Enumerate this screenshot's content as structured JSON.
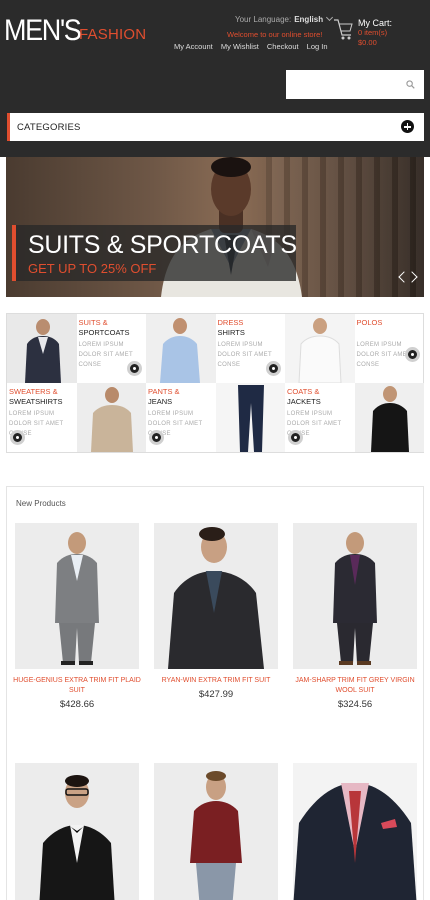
{
  "header": {
    "logo_main": "MEN'S",
    "logo_sub": "FASHION",
    "language_label": "Your Language:",
    "language_value": "English",
    "welcome": "Welcome to our online store!",
    "links": [
      "My Account",
      "My Wishlist",
      "Checkout",
      "Log In"
    ],
    "cart_title": "My Cart:",
    "cart_items": "0 item(s)",
    "cart_total": "$0.00",
    "search_placeholder": ""
  },
  "nav": {
    "categories_label": "CATEGORIES"
  },
  "banner": {
    "title": "SUITS & SPORTCOATS",
    "subtitle": "GET UP TO 25% OFF"
  },
  "categories": [
    {
      "line1": "SUITS &",
      "line2": "SPORTCOATS",
      "desc": "LOREM IPSUM DOLOR SIT AMET CONSE"
    },
    {
      "line1": "DRESS",
      "line2": "SHIRTS",
      "desc": "LOREM IPSUM DOLOR SIT AMET CONSE"
    },
    {
      "line1": "POLOS",
      "line2": "",
      "desc": "LOREM IPSUM DOLOR SIT AMET CONSE"
    },
    {
      "line1": "SWEATERS &",
      "line2": "SWEATSHIRTS",
      "desc": "LOREM IPSUM DOLOR SIT AMET CONSE"
    },
    {
      "line1": "PANTS &",
      "line2": "JEANS",
      "desc": "LOREM IPSUM DOLOR SIT AMET CONSE"
    },
    {
      "line1": "COATS &",
      "line2": "JACKETS",
      "desc": "LOREM IPSUM DOLOR SIT AMET CONSE"
    }
  ],
  "products_heading": "New Products",
  "products": [
    {
      "name": "HUGE-GENIUS EXTRA TRIM FIT PLAID SUIT",
      "price": "$428.66"
    },
    {
      "name": "RYAN-WIN EXTRA TRIM FIT SUIT",
      "price": "$427.99"
    },
    {
      "name": "JAM-SHARP TRIM FIT GREY VIRGIN WOOL SUIT",
      "price": "$324.56"
    }
  ],
  "colors": {
    "accent": "#e04e2f",
    "header_bg": "#2b2b2b"
  }
}
